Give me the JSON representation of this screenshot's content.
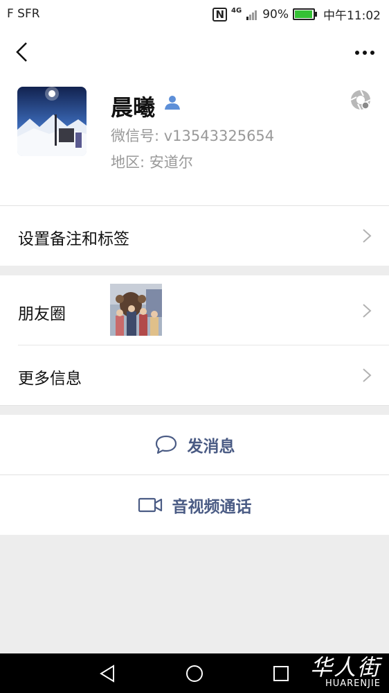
{
  "status_bar": {
    "carrier": "F SFR",
    "network": "4G",
    "battery": "90%",
    "time": "中午11:02"
  },
  "nav": {
    "back_icon": "chevron-left-icon",
    "more_icon": "more-dots-icon"
  },
  "profile": {
    "name": "晨曦",
    "wechat_id": "微信号: v13543325654",
    "region": "地区: 安道尔"
  },
  "menu": {
    "remarks_tags": "设置备注和标签",
    "moments": "朋友圈",
    "more_info": "更多信息"
  },
  "actions": {
    "send_message": "发消息",
    "video_call": "音视频通话"
  },
  "watermark": {
    "cn": "华人街",
    "en": "HUARENJIE"
  },
  "colors": {
    "action_text": "#4a5b84",
    "background": "#ededed",
    "battery": "#35c235"
  }
}
